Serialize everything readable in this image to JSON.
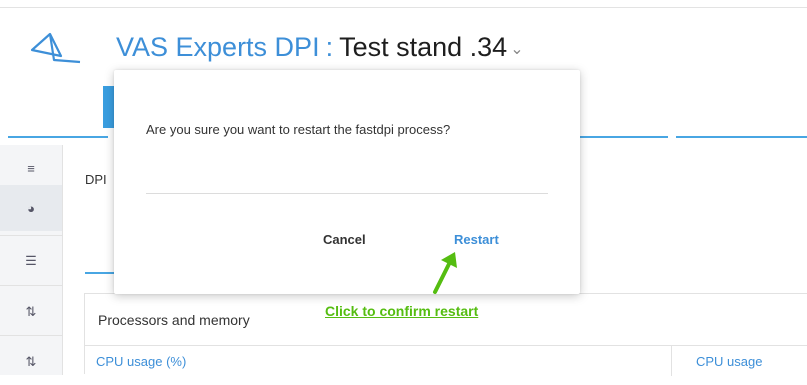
{
  "header": {
    "app_name": "VAS Experts DPI",
    "separator": ":",
    "stand_name": "Test stand .34",
    "chevron": "⌄"
  },
  "sidebar": {
    "items": [
      {
        "icon": "menu-icon",
        "glyph": "≡"
      },
      {
        "icon": "dashboard-icon",
        "glyph": "◕",
        "active": true
      },
      {
        "icon": "server-icon",
        "glyph": "☰"
      },
      {
        "icon": "sort-icon",
        "glyph": "⇅"
      },
      {
        "icon": "sort-alt-icon",
        "glyph": "⇅"
      }
    ]
  },
  "content": {
    "section_label": "DPI",
    "panel_title": "Processors and memory",
    "cpu_usage_left": "CPU usage (%)",
    "cpu_usage_right": "CPU usage"
  },
  "dialog": {
    "message": "Are you sure you want to restart the fastdpi process?",
    "cancel_label": "Cancel",
    "restart_label": "Restart"
  },
  "annotation": {
    "text": "Click to confirm restart",
    "color": "#55bd11"
  },
  "colors": {
    "accent": "#3d8fd8",
    "accent_bar": "#48a6e3"
  }
}
